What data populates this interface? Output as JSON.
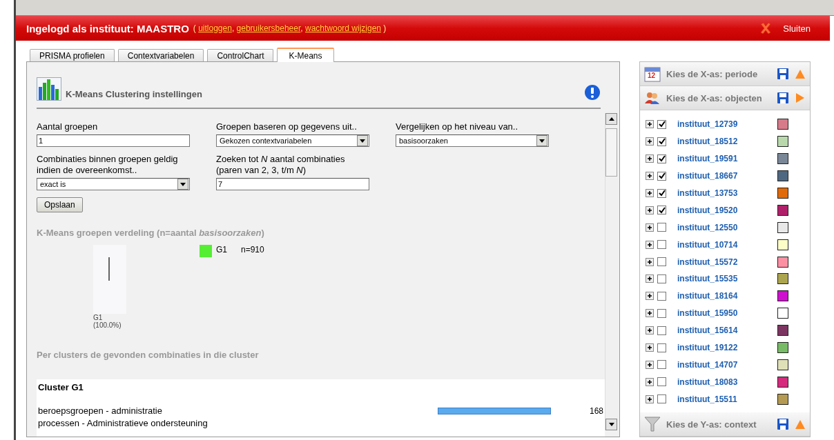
{
  "header": {
    "title": "Ingelogd als instituut: MAASTRO",
    "links_open": "(",
    "links": [
      "uitloggen",
      "gebruikersbeheer",
      "wachtwoord wijzigen"
    ],
    "link_separator": ",",
    "links_close": ")",
    "close": "Sluiten"
  },
  "tabs": [
    {
      "label": "PRISMA profielen",
      "selected": false
    },
    {
      "label": "Contextvariabelen",
      "selected": false
    },
    {
      "label": "ControlChart",
      "selected": false
    },
    {
      "label": "K-Means",
      "selected": true
    }
  ],
  "settings": {
    "title": "K-Means Clustering instellingen",
    "fields": [
      {
        "kind": "input",
        "label": "Aantal groepen",
        "value": "1"
      },
      {
        "kind": "select",
        "label": "Groepen baseren op gegevens uit..",
        "value": "Gekozen contextvariabelen"
      },
      {
        "kind": "select",
        "label": "Vergelijken op het niveau van..",
        "value": "basisoorzaken"
      },
      {
        "kind": "select",
        "label": "Combinaties binnen groepen geldig indien de overeenkomst..",
        "value": "exact is"
      },
      {
        "kind": "input",
        "label": "Zoeken tot *N* aantal combinaties (paren van 2, 3, t/m *N*)",
        "value": "7"
      }
    ],
    "save": "Opslaan"
  },
  "distribution": {
    "title": "K-Means groepen verdeling (n=aantal *basisoorzaken*)",
    "legend": [
      {
        "label": "G1",
        "count": "n=910",
        "color": "#55ee33"
      }
    ],
    "pie_label": "G1",
    "pie_percent": "(100.0%)"
  },
  "combinations": {
    "title": "Per clusters de gevonden combinaties in die cluster",
    "clusters": [
      {
        "name": "Cluster G1",
        "rows": [
          {
            "lines": [
              "beroepsgroepen - administratie",
              "processen - Administratieve ondersteuning"
            ],
            "count": "168"
          }
        ]
      }
    ]
  },
  "sidebar": {
    "sections": [
      {
        "kind": "period",
        "icon_text": "12",
        "title": "Kies de X-as: periode",
        "expanded": false
      },
      {
        "kind": "objects",
        "title": "Kies de X-as: objecten",
        "expanded": true,
        "items": [
          {
            "label": "instituut_12739",
            "checked": true,
            "color": "#d77b8b"
          },
          {
            "label": "instituut_18512",
            "checked": true,
            "color": "#b9d9ad"
          },
          {
            "label": "instituut_19591",
            "checked": true,
            "color": "#7a8797"
          },
          {
            "label": "instituut_18667",
            "checked": true,
            "color": "#4f6882"
          },
          {
            "label": "instituut_13753",
            "checked": true,
            "color": "#e06a0a"
          },
          {
            "label": "instituut_19520",
            "checked": true,
            "color": "#b0206a"
          },
          {
            "label": "instituut_12550",
            "checked": false,
            "color": "#e8e8e8"
          },
          {
            "label": "instituut_10714",
            "checked": false,
            "color": "#fdfdc8"
          },
          {
            "label": "instituut_15572",
            "checked": false,
            "color": "#fd8fa3"
          },
          {
            "label": "instituut_15535",
            "checked": false,
            "color": "#aca54f"
          },
          {
            "label": "instituut_18164",
            "checked": false,
            "color": "#d010cf"
          },
          {
            "label": "instituut_15950",
            "checked": false,
            "color": "#ffffff"
          },
          {
            "label": "instituut_15614",
            "checked": false,
            "color": "#7c3561"
          },
          {
            "label": "instituut_19122",
            "checked": false,
            "color": "#77bb66"
          },
          {
            "label": "instituut_14707",
            "checked": false,
            "color": "#e0e0b8"
          },
          {
            "label": "instituut_18083",
            "checked": false,
            "color": "#d62a7e"
          },
          {
            "label": "instituut_15511",
            "checked": false,
            "color": "#b49a52"
          }
        ]
      },
      {
        "kind": "context",
        "title": "Kies de Y-as: context",
        "expanded": false
      }
    ]
  }
}
